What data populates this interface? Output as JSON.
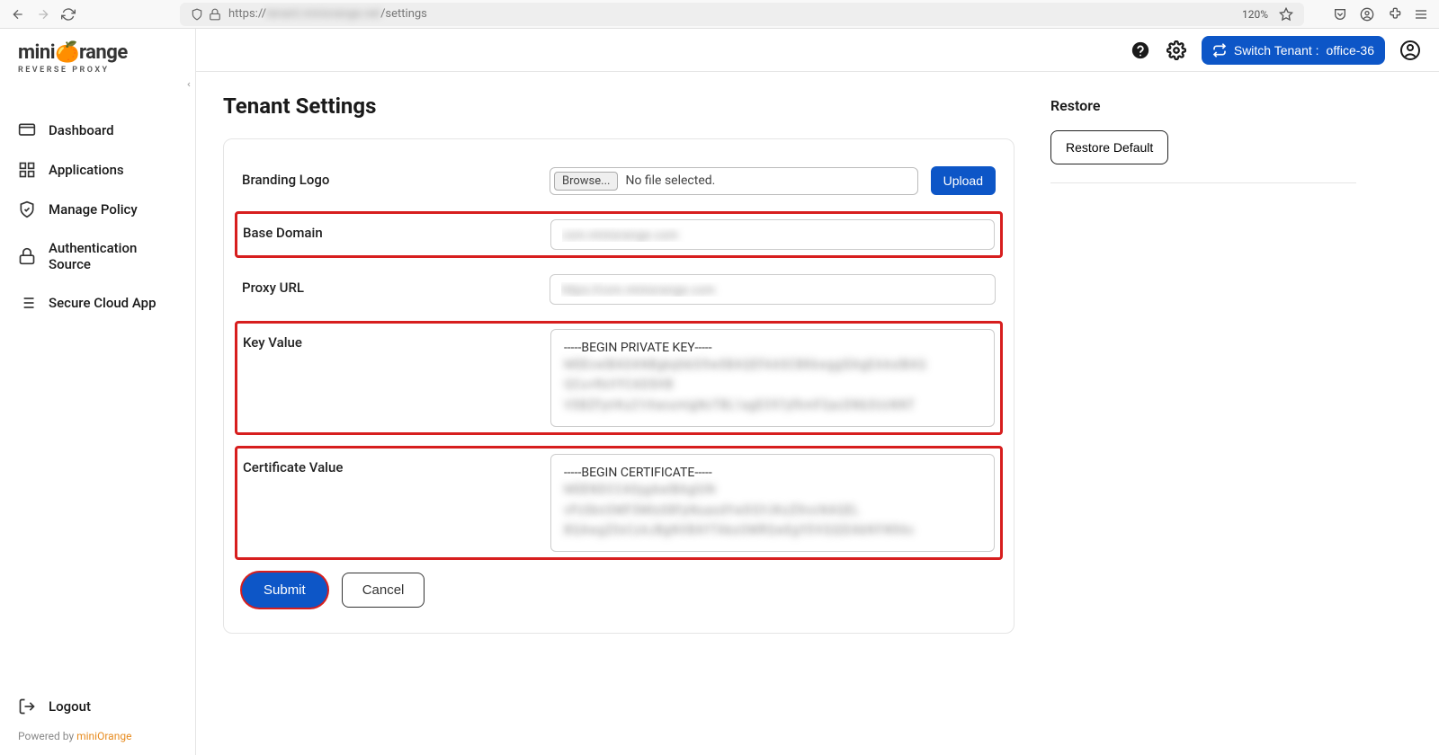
{
  "browser": {
    "url_prefix": "https://",
    "url_blurred": "tenant.miniorange.net",
    "url_suffix": "/settings",
    "zoom": "120%"
  },
  "brand": {
    "name_pre": "mini",
    "name_post": "range",
    "subtitle": "REVERSE PROXY",
    "powered_prefix": "Powered by ",
    "powered_link": "miniOrange"
  },
  "sidebar": {
    "items": [
      {
        "label": "Dashboard"
      },
      {
        "label": "Applications"
      },
      {
        "label": "Manage Policy"
      },
      {
        "label": "Authentication Source"
      },
      {
        "label": "Secure Cloud App"
      }
    ],
    "logout": "Logout"
  },
  "topbar": {
    "switch_prefix": "Switch Tenant :",
    "tenant_name": "office-36"
  },
  "page": {
    "title": "Tenant Settings",
    "restore_title": "Restore",
    "restore_btn": "Restore Default"
  },
  "form": {
    "branding_label": "Branding Logo",
    "browse_label": "Browse...",
    "no_file": "No file selected.",
    "upload_label": "Upload",
    "base_domain_label": "Base Domain",
    "base_domain_value": "csm.miniorange.com",
    "proxy_label": "Proxy URL",
    "proxy_value": "https://csm.miniorange.com",
    "key_label": "Key Value",
    "key_header": "-----BEGIN PRIVATE KEY-----",
    "key_body": "MIIEvwIBADANBgkqhkiG9w0BAQEFAASCBKkwggSlAgEAAoIBAQ QCu+RxVYCADSHB VSBZFyrrKu21rhavumigNcTBL1agEO97yfhmFQacDNb3UcNNT",
    "cert_label": "Certificate Value",
    "cert_header": "-----BEGIN CERTIFICATE-----",
    "cert_body": "MIIENDCCA0ygAwIBAgIUN vPzSknOMF3Mto08FpNuaodYwDQYJKoZIhvcNAQEL BQAwgZ0xCzAJBgNVBAYTAkoOMRQwEgYDVQQIDAkNYWhhc",
    "submit_label": "Submit",
    "cancel_label": "Cancel"
  }
}
